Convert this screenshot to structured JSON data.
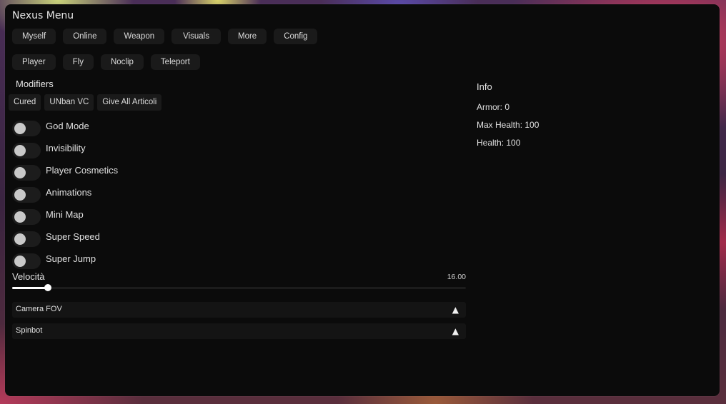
{
  "window": {
    "title": "Nexus Menu"
  },
  "tabs_row1": [
    "Myself",
    "Online",
    "Weapon",
    "Visuals",
    "More",
    "Config"
  ],
  "tabs_row2": [
    "Player",
    "Fly",
    "Noclip",
    "Teleport"
  ],
  "modifiers": {
    "label": "Modifiers",
    "buttons": [
      "Cured",
      "UNban VC",
      "Give All Articoli"
    ]
  },
  "toggles": [
    {
      "label": "God Mode",
      "on": false
    },
    {
      "label": "Invisibility",
      "on": false
    },
    {
      "label": "Player Cosmetics",
      "on": false
    },
    {
      "label": "Animations",
      "on": false
    },
    {
      "label": "Mini Map",
      "on": false
    },
    {
      "label": "Super Speed",
      "on": false
    },
    {
      "label": "Super Jump",
      "on": false
    }
  ],
  "slider": {
    "label": "Velocità",
    "value_text": "16.00",
    "fraction": 0.079
  },
  "collapsibles": [
    {
      "label": "Camera FOV",
      "arrow": "▲"
    },
    {
      "label": "Spinbot",
      "arrow": "▲"
    }
  ],
  "info": {
    "title": "Info",
    "lines": [
      "Armor: 0",
      "Max Health: 100",
      "Health: 100"
    ]
  },
  "colors": {
    "panel_bg": "#0b0b0b",
    "button_bg": "#1a1a1a",
    "text": "#e0e0e0",
    "slider_fill": "#ffffff"
  }
}
